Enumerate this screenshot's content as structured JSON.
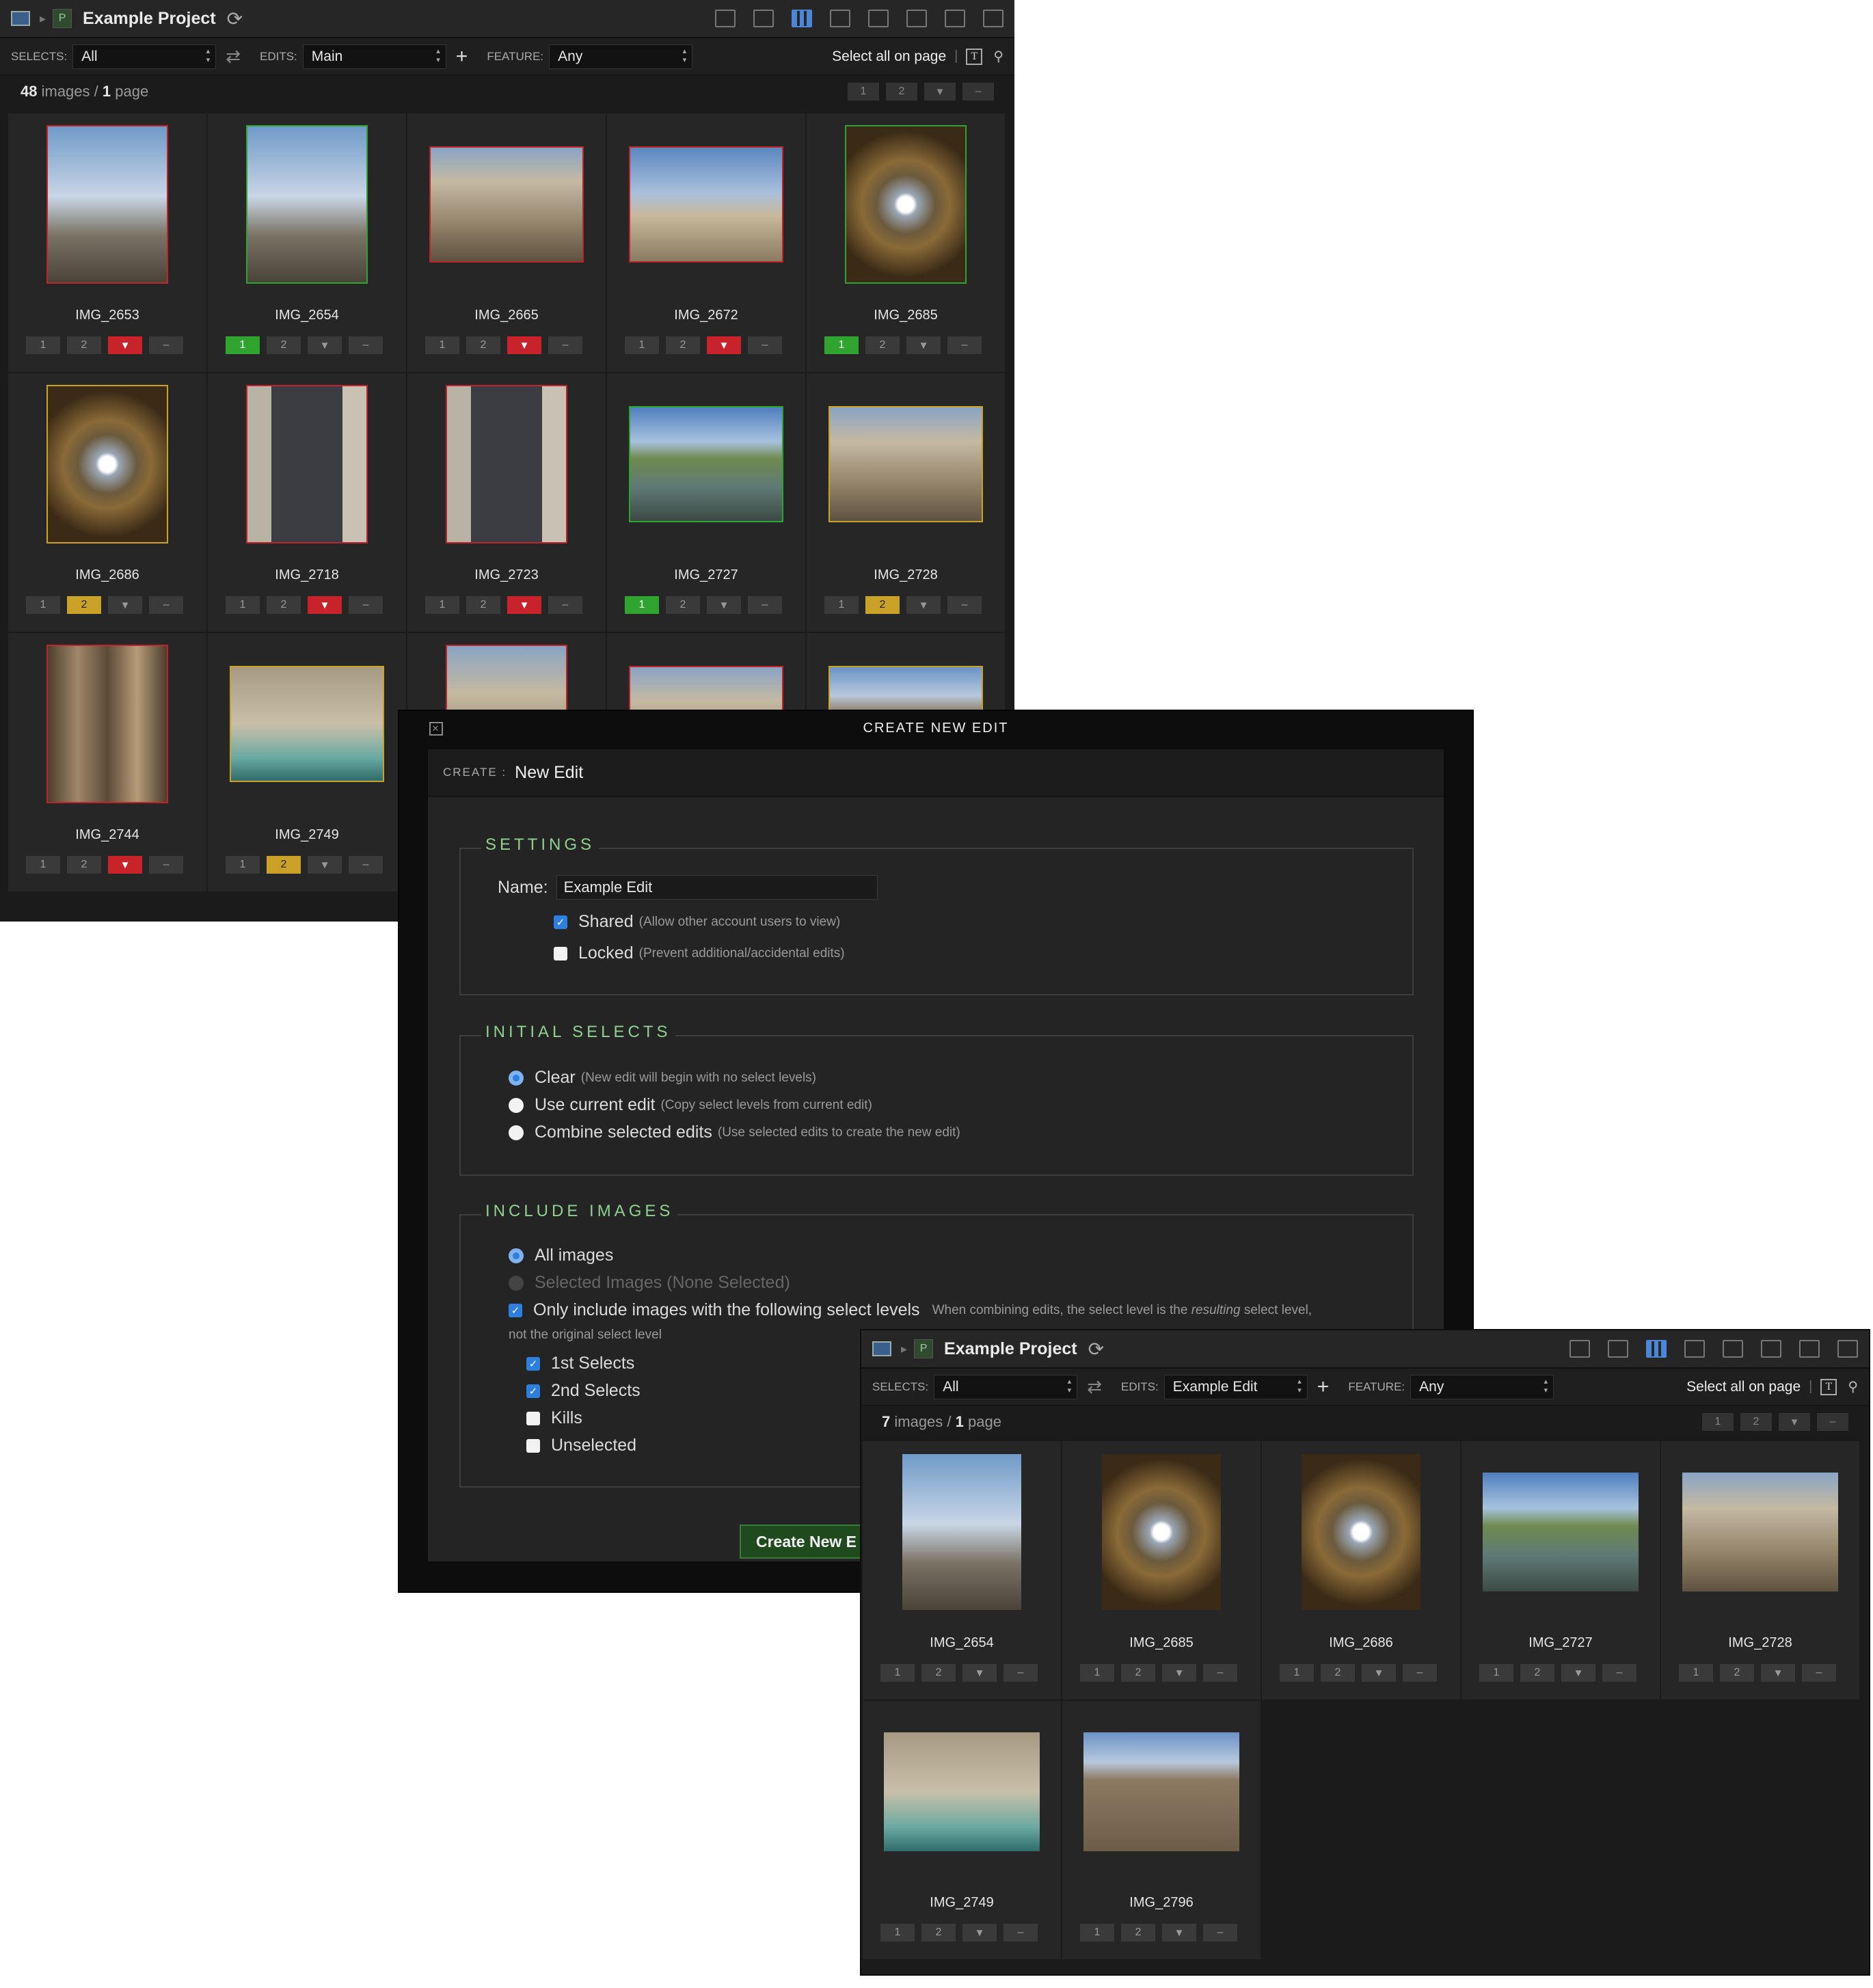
{
  "project": {
    "badge": "P",
    "title": "Example Project"
  },
  "filters": {
    "selects_label": "SELECTS:",
    "edits_label": "EDITS:",
    "feature_label": "FEATURE:",
    "selects_value": "All",
    "feature_value": "Any",
    "select_all_label": "Select all on page"
  },
  "pager": {
    "page1": "1",
    "page2": "2",
    "minus": "–"
  },
  "btn_labels": {
    "one": "1",
    "two": "2",
    "clear": "–"
  },
  "window1": {
    "edit_value": "Main",
    "count": "48",
    "count_suffix": "images",
    "pages": "1",
    "pages_suffix": "page",
    "images": [
      {
        "name": "IMG_2653",
        "level": "kill",
        "shape": "portrait",
        "photo": "sky"
      },
      {
        "name": "IMG_2654",
        "level": "1",
        "shape": "portrait",
        "photo": "sky"
      },
      {
        "name": "IMG_2665",
        "level": "kill",
        "shape": "land",
        "photo": "stone"
      },
      {
        "name": "IMG_2672",
        "level": "kill",
        "shape": "land",
        "photo": "sky2"
      },
      {
        "name": "IMG_2685",
        "level": "1",
        "shape": "portrait",
        "photo": "dome"
      },
      {
        "name": "IMG_2686",
        "level": "2",
        "shape": "portrait",
        "photo": "dome"
      },
      {
        "name": "IMG_2718",
        "level": "kill",
        "shape": "portrait",
        "photo": "gate"
      },
      {
        "name": "IMG_2723",
        "level": "kill",
        "shape": "portrait",
        "photo": "gate"
      },
      {
        "name": "IMG_2727",
        "level": "1",
        "shape": "land",
        "photo": "river"
      },
      {
        "name": "IMG_2728",
        "level": "2",
        "shape": "land",
        "photo": "stone"
      },
      {
        "name": "IMG_2744",
        "level": "kill",
        "shape": "portrait",
        "photo": "temple"
      },
      {
        "name": "IMG_2749",
        "level": "2",
        "shape": "land",
        "photo": "fountain"
      },
      {
        "name": "",
        "level": "",
        "shape": "portrait",
        "photo": "stone",
        "border": "red"
      },
      {
        "name": "",
        "level": "",
        "shape": "land",
        "photo": "stone",
        "border": "red"
      },
      {
        "name": "",
        "level": "",
        "shape": "land",
        "photo": "colos",
        "border": "yellow"
      }
    ]
  },
  "dialog": {
    "title": "CREATE NEW EDIT",
    "create_label": "CREATE :",
    "create_value": "New Edit",
    "settings": {
      "legend": "SETTINGS",
      "name_label": "Name:",
      "name_value": "Example Edit",
      "shared_label": "Shared",
      "shared_hint": "(Allow other account users to view)",
      "locked_label": "Locked",
      "locked_hint": "(Prevent additional/accidental edits)"
    },
    "initial": {
      "legend": "INITIAL SELECTS",
      "clear_label": "Clear",
      "clear_hint": "(New edit will begin with no select levels)",
      "current_label": "Use current edit",
      "current_hint": "(Copy select levels from current edit)",
      "combine_label": "Combine selected edits",
      "combine_hint": "(Use selected edits to create the new edit)"
    },
    "include": {
      "legend": "INCLUDE IMAGES",
      "all_label": "All images",
      "selected_label": "Selected Images (None Selected)",
      "only_label": "Only include images with the following select levels",
      "only_hint_a": "When combining edits, the select level is the",
      "only_hint_em": "resulting",
      "only_hint_b": "select level,",
      "only_hint_c": "not the original select level",
      "first_label": "1st Selects",
      "second_label": "2nd Selects",
      "kills_label": "Kills",
      "unselected_label": "Unselected"
    },
    "create_button": "Create New E"
  },
  "window2": {
    "edit_value": "Example Edit",
    "count": "7",
    "count_suffix": "images",
    "pages": "1",
    "pages_suffix": "page",
    "images": [
      {
        "name": "IMG_2654",
        "shape": "portrait",
        "photo": "sky"
      },
      {
        "name": "IMG_2685",
        "shape": "portrait",
        "photo": "dome"
      },
      {
        "name": "IMG_2686",
        "shape": "portrait",
        "photo": "dome"
      },
      {
        "name": "IMG_2727",
        "shape": "land",
        "photo": "river"
      },
      {
        "name": "IMG_2728",
        "shape": "land",
        "photo": "stone"
      },
      {
        "name": "IMG_2749",
        "shape": "land",
        "photo": "fountain"
      },
      {
        "name": "IMG_2796",
        "shape": "land",
        "photo": "colos"
      }
    ]
  }
}
